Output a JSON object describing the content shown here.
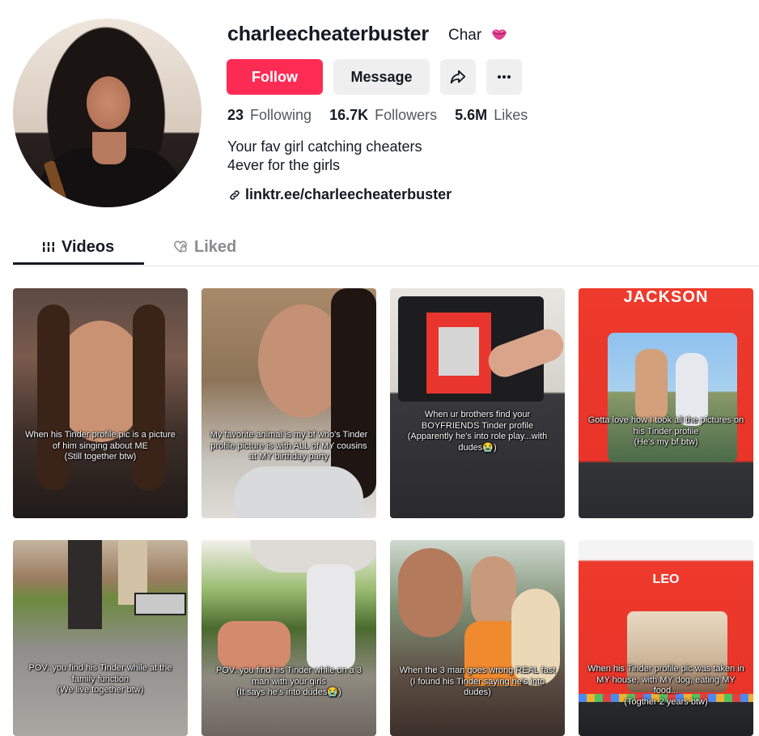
{
  "profile": {
    "username": "charleecheaterbuster",
    "nickname": "Char",
    "follow_label": "Follow",
    "message_label": "Message",
    "stats": {
      "following_count": "23",
      "following_label": "Following",
      "followers_count": "16.7K",
      "followers_label": "Followers",
      "likes_count": "5.6M",
      "likes_label": "Likes"
    },
    "bio_line1": "Your fav girl catching cheaters",
    "bio_line2": "4ever for the girls",
    "link": "linktr.ee/charleecheaterbuster"
  },
  "tabs": {
    "videos": "Videos",
    "liked": "Liked"
  },
  "colors": {
    "accent": "#fe2c55",
    "button_gray": "#efeff0",
    "text": "#161823"
  },
  "videos": [
    {
      "caption": "When his Tinder profile pic is a picture of him singing about ME\n(Still together btw)"
    },
    {
      "caption": "My favorite animal is my bf who's Tinder profile picture is with ALL of MY cousins at MY birthday party"
    },
    {
      "caption": "When ur brothers find your BOYFRIENDS Tinder profile\n(Apparently he's into role play...with dudes😭)"
    },
    {
      "caption": "Gotta love how I took all the pictures on his Tinder profile\n(He's my bf btw)",
      "overlay_title": "JACKSON"
    },
    {
      "caption": "POV: you find his Tinder while at the family function\n(We live together btw)"
    },
    {
      "caption": "POV: you find his Tinder while on a 3 man with your girls\n(It says he's into dudes😭)"
    },
    {
      "caption": "When the 3 man goes wrong REAL fast\n(I found his Tinder saying he's into dudes)"
    },
    {
      "caption": "When his Tinder profile pic was taken in MY house, with MY dog, eating MY food...\n(Togther 2 years btw)",
      "overlay_title": "LEO"
    }
  ]
}
